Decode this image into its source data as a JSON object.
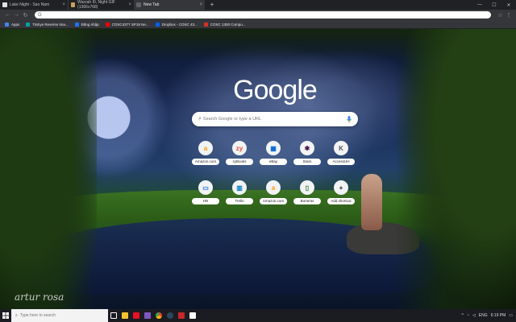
{
  "tabs": [
    {
      "title": "Lake Night - Sao Nam",
      "favicon_color": "#e0e0e0"
    },
    {
      "title": "Warzah III, Night GIF (1366x768)",
      "favicon_color": "#c8a060"
    },
    {
      "title": "New Tab",
      "favicon_color": "#5f6368"
    }
  ],
  "toolbar": {
    "omnibox_value": "",
    "omnibox_prefix": "G"
  },
  "bookmarks": [
    {
      "label": "Apps",
      "color": "#4285f4"
    },
    {
      "label": "TinEye Reverse Ima...",
      "color": "#00a3a3"
    },
    {
      "label": "Đăng nhập",
      "color": "#1877f2"
    },
    {
      "label": "COSC4377 SP19 Ne...",
      "color": "#ff0000"
    },
    {
      "label": "Dropbox - COSC 43...",
      "color": "#0061ff"
    },
    {
      "label": "COSC 1300 Compu...",
      "color": "#d93025"
    }
  ],
  "logo": {
    "text": "Google"
  },
  "search": {
    "placeholder": "Search Google or type a URL"
  },
  "shortcuts": [
    {
      "label": "Amazon.com",
      "glyph": "a",
      "color": "#ff9900"
    },
    {
      "label": "zyBooks",
      "glyph": "zy",
      "color": "#e94e3a"
    },
    {
      "label": "eBay",
      "glyph": "▦",
      "color": "#0064d2"
    },
    {
      "label": "Slack",
      "glyph": "✱",
      "color": "#4a154b"
    },
    {
      "label": "AccessUH",
      "glyph": "K",
      "color": "#555555"
    },
    {
      "label": "HN",
      "glyph": "▭",
      "color": "#1a73e8"
    },
    {
      "label": "Trello",
      "glyph": "▥",
      "color": "#0079bf"
    },
    {
      "label": "Amazon.com",
      "glyph": "a",
      "color": "#ff9900"
    },
    {
      "label": "Boneras",
      "glyph": "▯",
      "color": "#2e7d32"
    },
    {
      "label": "Add shortcut",
      "glyph": "+",
      "color": "#202124"
    }
  ],
  "watermark": "artur rosa",
  "taskbar": {
    "search_placeholder": "Type here to search",
    "apps": [
      {
        "name": "task-view",
        "color": "#ffffff"
      },
      {
        "name": "explorer",
        "color": "#f4c430"
      },
      {
        "name": "media",
        "color": "#e81123"
      },
      {
        "name": "visual-studio",
        "color": "#7e57c2"
      },
      {
        "name": "chrome",
        "color": "#34a853"
      },
      {
        "name": "steam",
        "color": "#1b2838"
      },
      {
        "name": "app-red",
        "color": "#c62828"
      },
      {
        "name": "photos",
        "color": "#ffffff"
      }
    ],
    "tray": {
      "lang": "ENG",
      "time": "6:19 PM"
    }
  }
}
